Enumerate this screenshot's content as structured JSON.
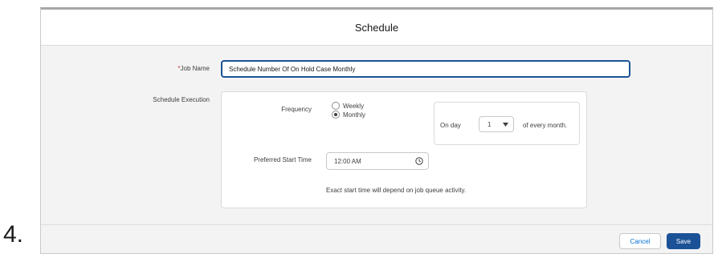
{
  "step_number": "4.",
  "modal": {
    "title": "Schedule"
  },
  "form": {
    "job_name": {
      "required_marker": "*",
      "label": "Job Name",
      "value": "Schedule Number Of On Hold Case Monthly"
    },
    "schedule_execution": {
      "label": "Schedule Execution",
      "frequency": {
        "label": "Frequency",
        "options": [
          {
            "label": "Weekly",
            "selected": false
          },
          {
            "label": "Monthly",
            "selected": true
          }
        ]
      },
      "monthly": {
        "prefix": "On day",
        "day_value": "1",
        "suffix": "of every month."
      },
      "start_time": {
        "label": "Preferred Start Time",
        "value": "12:00 AM",
        "icon": "clock-icon"
      },
      "hint": "Exact start time will depend on job queue activity."
    }
  },
  "footer": {
    "cancel_label": "Cancel",
    "save_label": "Save"
  },
  "colors": {
    "primary": "#1b5297",
    "link": "#0070d2",
    "required": "#c23934",
    "body_bg": "#f3f3f3"
  }
}
